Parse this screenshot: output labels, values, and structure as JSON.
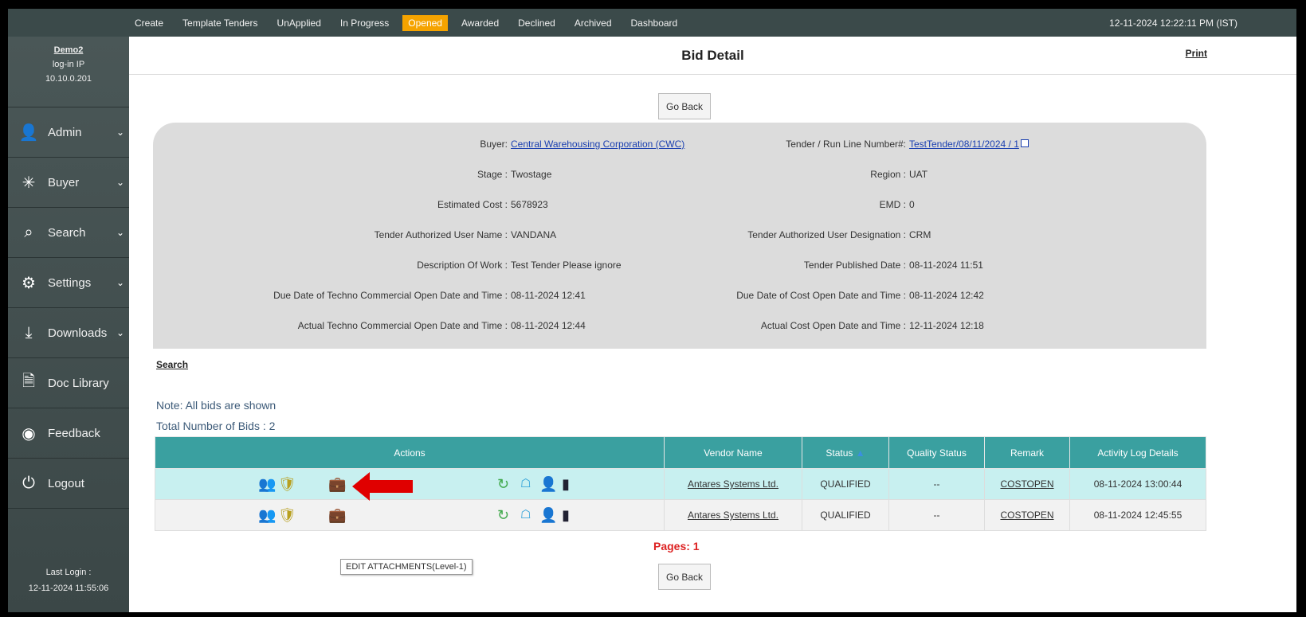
{
  "nav": {
    "tabs": [
      "Create",
      "Template Tenders",
      "UnApplied",
      "In Progress",
      "Opened",
      "Awarded",
      "Declined",
      "Archived",
      "Dashboard"
    ],
    "active_tab": "Opened",
    "datetime": "12-11-2024 12:22:11 PM (IST)"
  },
  "sidebar": {
    "user_name": "Demo2",
    "login_ip_label": "log-in IP",
    "login_ip": "10.10.0.201",
    "items": [
      {
        "label": "Admin",
        "icon": "user-admin-icon",
        "chevron": true
      },
      {
        "label": "Buyer",
        "icon": "buyer-icon",
        "chevron": true
      },
      {
        "label": "Search",
        "icon": "search-icon",
        "chevron": true
      },
      {
        "label": "Settings",
        "icon": "settings-icon",
        "chevron": true
      },
      {
        "label": "Downloads",
        "icon": "download-icon",
        "chevron": true
      },
      {
        "label": "Doc Library",
        "icon": "document-icon",
        "chevron": false
      },
      {
        "label": "Feedback",
        "icon": "feedback-icon",
        "chevron": false
      },
      {
        "label": "Logout",
        "icon": "power-icon",
        "chevron": false
      }
    ],
    "last_login_label": "Last Login :",
    "last_login": "12-11-2024 11:55:06"
  },
  "page": {
    "title": "Bid Detail",
    "print": "Print",
    "go_back": "Go Back"
  },
  "info": {
    "buyer_k": "Buyer:",
    "buyer_v": "Central Warehousing Corporation (CWC)",
    "tender_k": "Tender / Run Line Number#:",
    "tender_v": "TestTender/08/11/2024 / 1",
    "stage_k": "Stage :",
    "stage_v": "Twostage",
    "region_k": "Region :",
    "region_v": "UAT",
    "cost_k": "Estimated Cost :",
    "cost_v": "5678923",
    "emd_k": "EMD :",
    "emd_v": "0",
    "auth_user_k": "Tender Authorized User Name :",
    "auth_user_v": "VANDANA",
    "auth_desig_k": "Tender Authorized User Designation :",
    "auth_desig_v": "CRM",
    "desc_k": "Description Of Work :",
    "desc_v": "Test Tender Please ignore",
    "pub_k": "Tender Published Date :",
    "pub_v": "08-11-2024 11:51",
    "due_tc_k": "Due Date of Techno Commercial Open Date and Time :",
    "due_tc_v": "08-11-2024 12:41",
    "due_cost_k": "Due Date of Cost Open Date and Time :",
    "due_cost_v": "08-11-2024 12:42",
    "act_tc_k": "Actual Techno Commercial Open Date and Time :",
    "act_tc_v": "08-11-2024 12:44",
    "act_cost_k": "Actual Cost Open Date and Time :",
    "act_cost_v": "12-11-2024 12:18"
  },
  "search_link": "Search",
  "note": "Note: All bids are shown",
  "total": "Total Number of Bids : 2",
  "table": {
    "headers": [
      "Actions",
      "Vendor Name",
      "Status",
      "Quality Status",
      "Remark",
      "Activity Log Details"
    ],
    "rows": [
      {
        "vendor": "Antares Systems Ltd.",
        "status": "QUALIFIED",
        "quality": "--",
        "remark": "COSTOPEN",
        "log": "08-11-2024 13:00:44"
      },
      {
        "vendor": "Antares Systems Ltd.",
        "status": "QUALIFIED",
        "quality": "--",
        "remark": "COSTOPEN",
        "log": "08-11-2024 12:45:55"
      }
    ]
  },
  "pages": "Pages:   1",
  "tooltip": "EDIT ATTACHMENTS(Level-1)",
  "colors": {
    "accent": "#f5a300",
    "header": "#3aa0a0",
    "sidebar": "#3b4a4a",
    "arrow": "#e00000"
  }
}
